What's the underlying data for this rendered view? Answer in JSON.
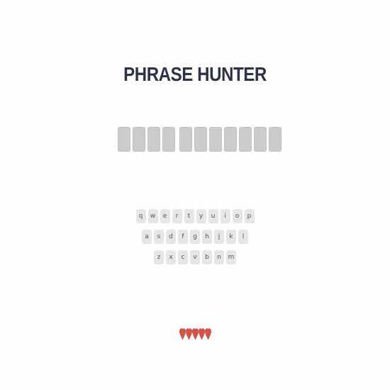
{
  "title": "PHRASE HUNTER",
  "phrase": {
    "words": [
      4,
      7
    ],
    "revealed": []
  },
  "keyboard": {
    "rows": [
      [
        "q",
        "w",
        "e",
        "r",
        "t",
        "y",
        "u",
        "i",
        "o",
        "p"
      ],
      [
        "a",
        "s",
        "d",
        "f",
        "g",
        "h",
        "j",
        "k",
        "l"
      ],
      [
        "z",
        "x",
        "c",
        "v",
        "b",
        "n",
        "m"
      ]
    ]
  },
  "lives": {
    "remaining": 5,
    "icon": "heart-icon",
    "color": "#d1544a"
  },
  "colors": {
    "title": "#2f3148",
    "tile": "#cccccc",
    "key_bg": "#e6e6e6",
    "key_text": "#555555"
  }
}
